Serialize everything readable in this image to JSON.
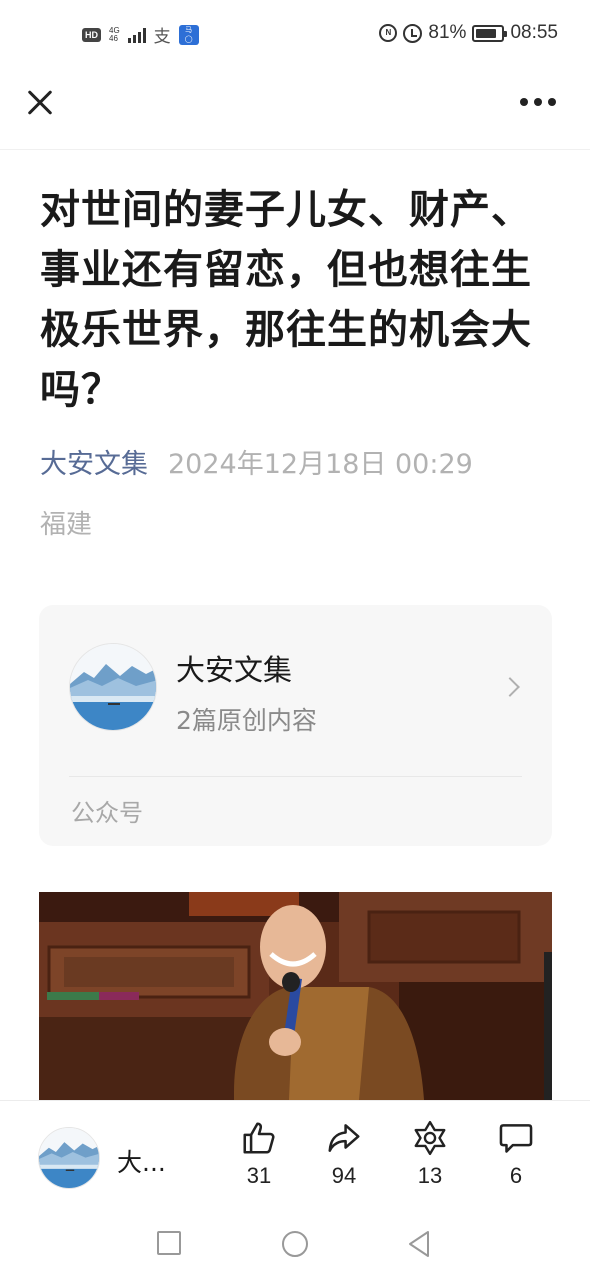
{
  "status_bar": {
    "hd": "HD",
    "network": "4G",
    "network_sub": "46",
    "app_icon_1": "alipay-icon",
    "app_icon_2": "news-app-icon",
    "nfc_label": "N",
    "battery_percent": "81%",
    "battery_level": 0.81,
    "time": "08:55"
  },
  "nav": {
    "close_icon": "close-icon",
    "more_icon": "more-dots-icon"
  },
  "article": {
    "title": "对世间的妻子儿女、财产、事业还有留恋，但也想往生极乐世界，那往生的机会大吗？",
    "author": "大安文集",
    "date": "2024年12月18日 00:29",
    "location": "福建"
  },
  "account_card": {
    "name": "大安文集",
    "description": "2篇原创内容",
    "type_label": "公众号",
    "avatar_icon": "landscape-avatar",
    "chevron_icon": "chevron-right-icon"
  },
  "toolbar": {
    "account_name": "大...",
    "like_count": "31",
    "share_count": "94",
    "recommend_count": "13",
    "comment_count": "6",
    "colors": {
      "icon": "#222222"
    }
  },
  "system_nav": {
    "recent_icon": "square-icon",
    "home_icon": "circle-icon",
    "back_icon": "triangle-back-icon"
  },
  "colors": {
    "link": "#576b95",
    "muted": "#b2b2b2",
    "card_bg": "#f7f7f7",
    "robe": "#7a4a22"
  }
}
